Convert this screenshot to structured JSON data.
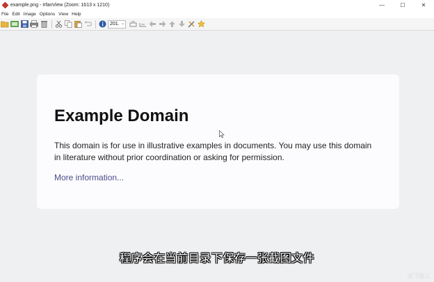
{
  "window": {
    "title": "example.png - IrfanView (Zoom: 1613 x 1210)",
    "controls": {
      "minimize": "—",
      "maximize": "☐",
      "close": "✕"
    }
  },
  "menu": [
    "File",
    "Edit",
    "Image",
    "Options",
    "View",
    "Help"
  ],
  "toolbar": {
    "zoom_value": "201.",
    "icons": [
      "open-folder-icon",
      "slideshow-icon",
      "save-icon",
      "print-icon",
      "delete-icon",
      "cut-icon",
      "copy-icon",
      "paste-icon",
      "undo-icon",
      "info-icon",
      "zoom-in-icon",
      "zoom-out-icon",
      "prev-icon",
      "next-icon",
      "first-icon",
      "last-icon",
      "settings-icon",
      "favorites-icon"
    ]
  },
  "page": {
    "heading": "Example Domain",
    "body": "This domain is for use in illustrative examples in documents. You may use this domain in literature without prior coordination or asking for permission.",
    "link": "More information..."
  },
  "subtitle": "程序会在当前目录下保存一张截图文件",
  "watermark": "自下而上"
}
